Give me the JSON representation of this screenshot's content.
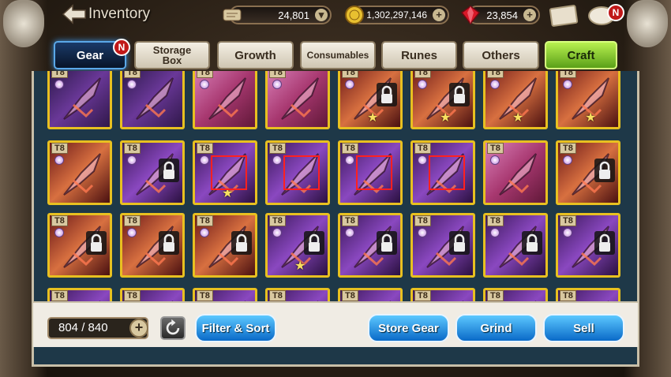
{
  "header": {
    "title": "Inventory"
  },
  "resources": {
    "scrolls": {
      "value": "24,801",
      "icon": "scroll-icon"
    },
    "gold": {
      "value": "1,302,297,146",
      "icon": "gold-coin-icon"
    },
    "rubies": {
      "value": "23,854",
      "icon": "ruby-icon"
    }
  },
  "badges": {
    "gear_new": "N",
    "chat_new": "N"
  },
  "tabs": [
    {
      "label": "Gear"
    },
    {
      "label": "Storage Box"
    },
    {
      "label": "Growth"
    },
    {
      "label": "Consumables"
    },
    {
      "label": "Runes"
    },
    {
      "label": "Others"
    },
    {
      "label": "Craft"
    }
  ],
  "items_tier": "T8",
  "inventory": {
    "count": "804 / 840",
    "plus": "+"
  },
  "buttons": {
    "filter": "Filter & Sort",
    "store": "Store Gear",
    "grind": "Grind",
    "sell": "Sell"
  },
  "colors": {
    "frame_gold": "#e8c020",
    "panel": "#1e3848",
    "blue_button": "#1a8ae0",
    "craft_green": "#8ad830"
  }
}
